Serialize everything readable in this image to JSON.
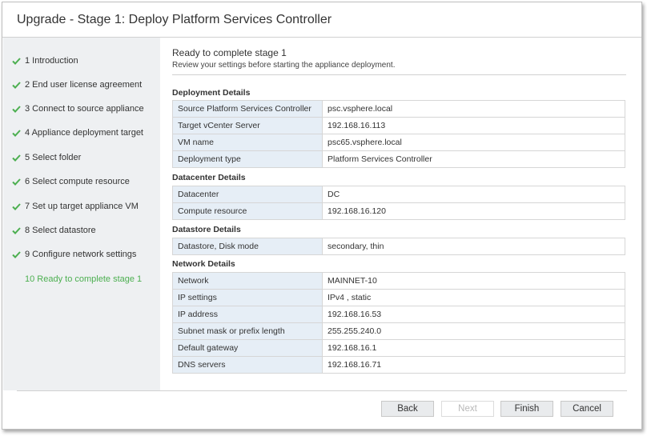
{
  "window": {
    "title": "Upgrade - Stage 1: Deploy Platform Services Controller"
  },
  "steps": [
    {
      "label": "1 Introduction",
      "done": true
    },
    {
      "label": "2 End user license agreement",
      "done": true
    },
    {
      "label": "3 Connect to source appliance",
      "done": true
    },
    {
      "label": "4 Appliance deployment target",
      "done": true
    },
    {
      "label": "5 Select folder",
      "done": true
    },
    {
      "label": "6 Select compute resource",
      "done": true
    },
    {
      "label": "7 Set up target appliance VM",
      "done": true
    },
    {
      "label": "8 Select datastore",
      "done": true
    },
    {
      "label": "9 Configure network settings",
      "done": true
    },
    {
      "label": "10 Ready to complete stage 1",
      "done": false
    }
  ],
  "main": {
    "title": "Ready to complete stage 1",
    "subtitle": "Review your settings before starting the appliance deployment."
  },
  "sections": [
    {
      "title": "Deployment Details",
      "rows": [
        {
          "key": "Source Platform Services Controller",
          "value": "psc.vsphere.local"
        },
        {
          "key": "Target vCenter Server",
          "value": "192.168.16.113"
        },
        {
          "key": "VM name",
          "value": "psc65.vsphere.local"
        },
        {
          "key": "Deployment type",
          "value": "Platform Services Controller"
        }
      ]
    },
    {
      "title": "Datacenter Details",
      "rows": [
        {
          "key": "Datacenter",
          "value": "DC"
        },
        {
          "key": "Compute resource",
          "value": "192.168.16.120"
        }
      ]
    },
    {
      "title": "Datastore Details",
      "rows": [
        {
          "key": "Datastore, Disk mode",
          "value": "secondary, thin"
        }
      ]
    },
    {
      "title": "Network Details",
      "rows": [
        {
          "key": "Network",
          "value": "MAINNET-10"
        },
        {
          "key": "IP settings",
          "value": "IPv4 , static"
        },
        {
          "key": "IP address",
          "value": "192.168.16.53"
        },
        {
          "key": "Subnet mask or prefix length",
          "value": "255.255.240.0"
        },
        {
          "key": "Default gateway",
          "value": "192.168.16.1"
        },
        {
          "key": "DNS servers",
          "value": "192.168.16.71"
        }
      ]
    }
  ],
  "buttons": {
    "back": "Back",
    "next": "Next",
    "finish": "Finish",
    "cancel": "Cancel"
  },
  "colors": {
    "check": "#4caf50",
    "active_step": "#4caf50",
    "key_cell_bg": "#e6eef6",
    "sidebar_bg": "#eef0f2"
  }
}
